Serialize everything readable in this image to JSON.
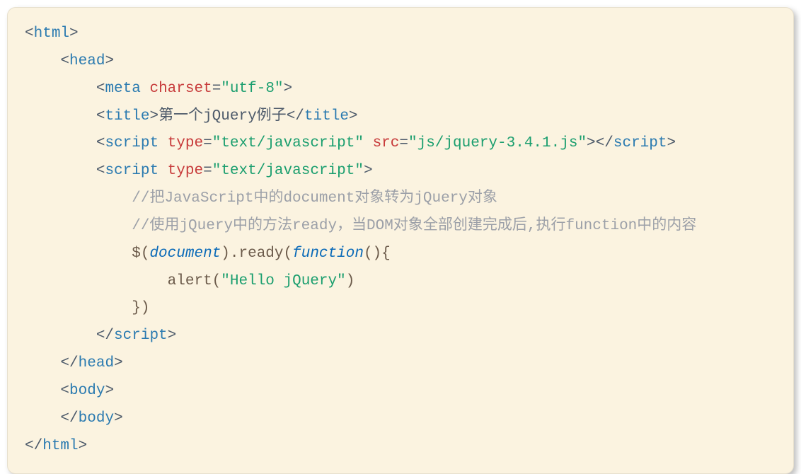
{
  "code": {
    "l1": {
      "p1": "<",
      "tag": "html",
      "p2": ">"
    },
    "l2": {
      "indent": "    ",
      "p1": "<",
      "tag": "head",
      "p2": ">"
    },
    "l3": {
      "indent": "        ",
      "p1": "<",
      "tag": "meta",
      "sp": " ",
      "attr": "charset",
      "eq": "=",
      "q1": "\"",
      "val": "utf-8",
      "q2": "\"",
      "p2": ">"
    },
    "l4": {
      "indent": "        ",
      "p1": "<",
      "tag": "title",
      "p2": ">",
      "text": "第一个jQuery例子",
      "p3": "</",
      "tag2": "title",
      "p4": ">"
    },
    "l5": {
      "indent": "        ",
      "p1": "<",
      "tag": "script",
      "sp": " ",
      "attr1": "type",
      "eq1": "=",
      "q1": "\"",
      "val1": "text/javascript",
      "q2": "\"",
      "sp2": " ",
      "attr2": "src",
      "eq2": "=",
      "q3": "\"",
      "val2": "js/jquery-3.4.1.js",
      "q4": "\"",
      "p2": "></",
      "tag2": "script",
      "p3": ">"
    },
    "l6": {
      "indent": "        ",
      "p1": "<",
      "tag": "script",
      "sp": " ",
      "attr": "type",
      "eq": "=",
      "q1": "\"",
      "val": "text/javascript",
      "q2": "\"",
      "p2": ">"
    },
    "l7": {
      "indent": "            ",
      "bar": "",
      "comment": "//把JavaScript中的document对象转为jQuery对象"
    },
    "l8": {
      "indent": "            ",
      "bar": "",
      "comment": "//使用jQuery中的方法ready，当DOM对象全部创建完成后,执行function中的内容"
    },
    "l9": {
      "indent": "            ",
      "bar": "",
      "dollar": "$(",
      "doc": "document",
      "p1": ").",
      "ready": "ready",
      "p2": "(",
      "func": "function",
      "p3": "(){"
    },
    "l10": {
      "indent": "            ",
      "bar": "    ",
      "alert": "alert",
      "p1": "(",
      "q1": "\"",
      "str": "Hello jQuery",
      "q2": "\"",
      "p2": ")"
    },
    "l11": {
      "indent": "            ",
      "bar": "",
      "p1": "})"
    },
    "l12": {
      "indent": "        ",
      "p1": "</",
      "tag": "script",
      "p2": ">"
    },
    "l13": {
      "indent": "    ",
      "p1": "</",
      "tag": "head",
      "p2": ">"
    },
    "l14": {
      "indent": "    ",
      "p1": "<",
      "tag": "body",
      "p2": ">"
    },
    "l15": {
      "indent": "    ",
      "p1": "</",
      "tag": "body",
      "p2": ">"
    },
    "l16": {
      "p1": "</",
      "tag": "html",
      "p2": ">"
    }
  }
}
